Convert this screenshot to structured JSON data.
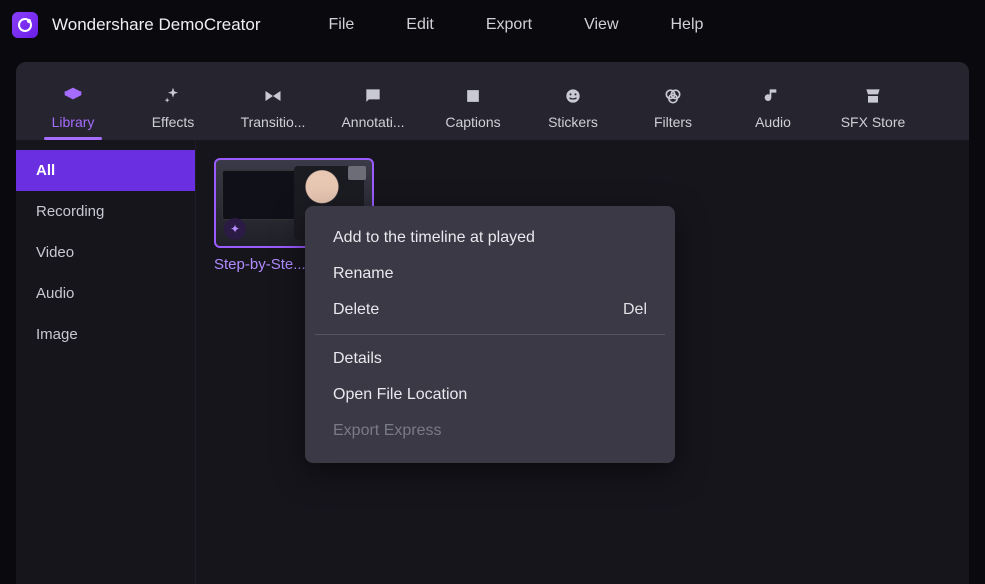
{
  "app": {
    "title": "Wondershare DemoCreator"
  },
  "menubar": {
    "items": [
      "File",
      "Edit",
      "Export",
      "View",
      "Help"
    ]
  },
  "ribbon": {
    "tabs": [
      {
        "label": "Library",
        "active": true
      },
      {
        "label": "Effects"
      },
      {
        "label": "Transitio..."
      },
      {
        "label": "Annotati..."
      },
      {
        "label": "Captions"
      },
      {
        "label": "Stickers"
      },
      {
        "label": "Filters"
      },
      {
        "label": "Audio"
      },
      {
        "label": "SFX Store"
      }
    ]
  },
  "sidebar": {
    "items": [
      {
        "label": "All",
        "active": true
      },
      {
        "label": "Recording"
      },
      {
        "label": "Video"
      },
      {
        "label": "Audio"
      },
      {
        "label": "Image"
      }
    ]
  },
  "clip": {
    "label": "Step-by-Ste..."
  },
  "context_menu": {
    "items": [
      {
        "label": "Add to the timeline at played"
      },
      {
        "label": "Rename"
      },
      {
        "label": "Delete",
        "shortcut": "Del"
      },
      {
        "sep": true
      },
      {
        "label": "Details"
      },
      {
        "label": "Open File Location"
      },
      {
        "label": "Export Express",
        "disabled": true
      }
    ]
  }
}
